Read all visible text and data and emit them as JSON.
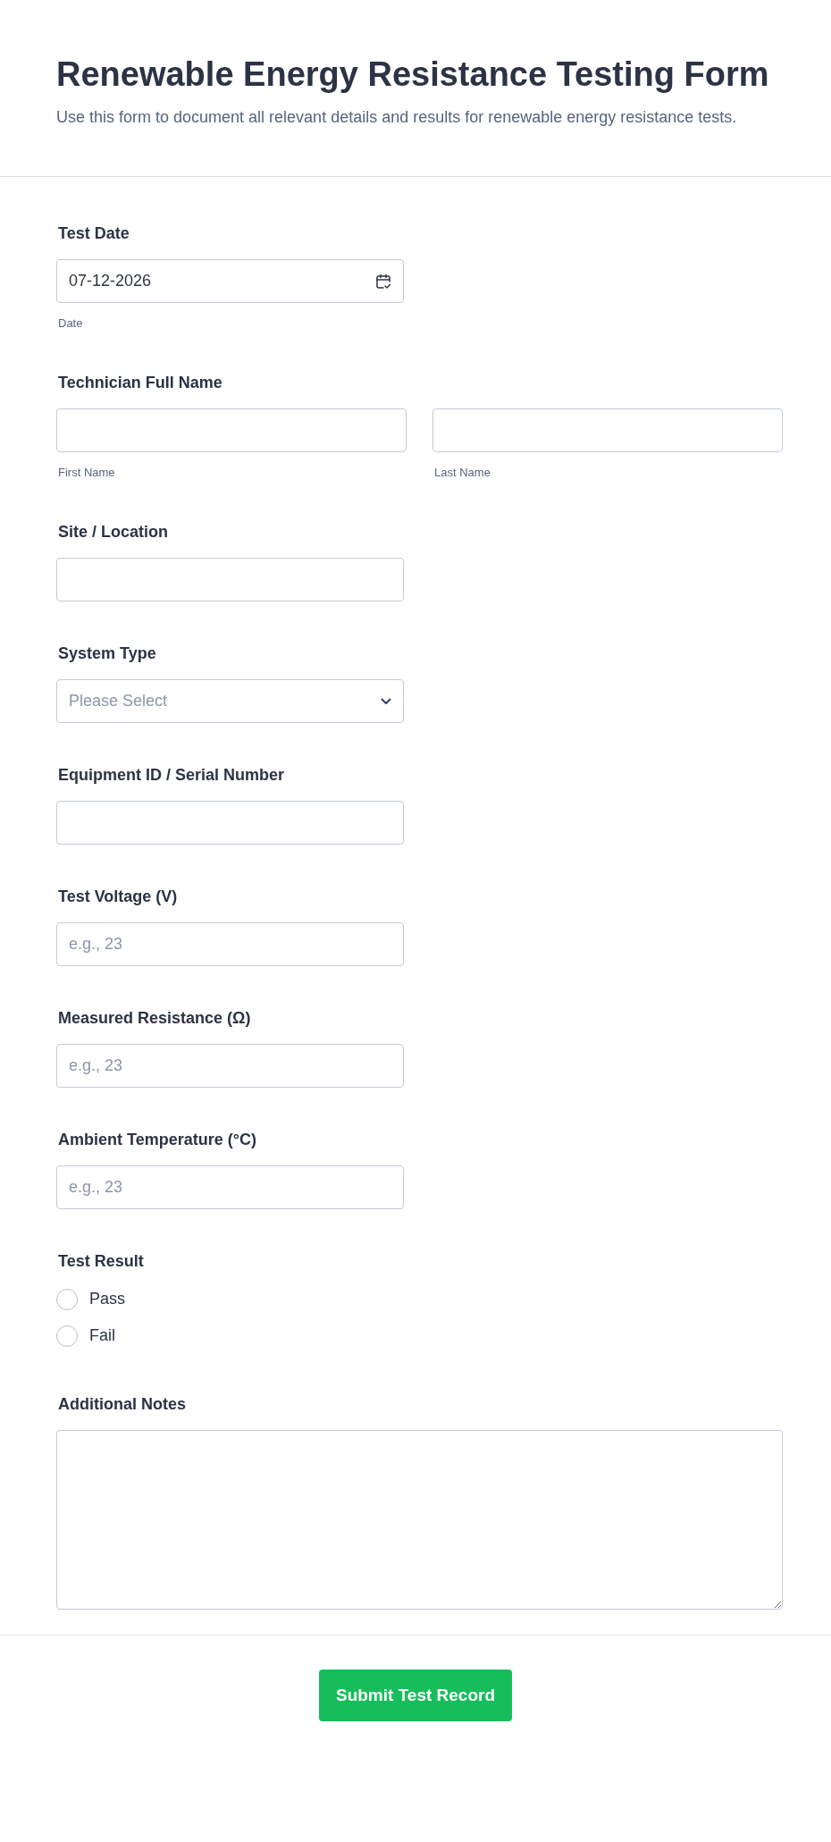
{
  "header": {
    "title": "Renewable Energy Resistance Testing Form",
    "description": "Use this form to document all relevant details and results for renewable energy resistance tests."
  },
  "fields": [
    {
      "kind": "date",
      "label": "Test Date",
      "value": "07-12-2026",
      "sublabel": "Date"
    },
    {
      "kind": "name",
      "label": "Technician Full Name",
      "parts": [
        {
          "sublabel": "First Name"
        },
        {
          "sublabel": "Last Name"
        }
      ]
    },
    {
      "kind": "text",
      "label": "Site / Location"
    },
    {
      "kind": "select",
      "label": "System Type",
      "placeholder": "Please Select"
    },
    {
      "kind": "text",
      "label": "Equipment ID / Serial Number"
    },
    {
      "kind": "text",
      "label": "Test Voltage (V)",
      "placeholder": "e.g., 23"
    },
    {
      "kind": "text",
      "label": "Measured Resistance (Ω)",
      "placeholder": "e.g., 23"
    },
    {
      "kind": "text",
      "label": "Ambient Temperature (°C)",
      "placeholder": "e.g., 23"
    },
    {
      "kind": "radio",
      "label": "Test Result",
      "options": [
        {
          "label": "Pass",
          "selected": false
        },
        {
          "label": "Fail",
          "selected": false
        }
      ]
    },
    {
      "kind": "textarea",
      "label": "Additional Notes"
    }
  ],
  "submit": {
    "label": "Submit Test Record"
  }
}
